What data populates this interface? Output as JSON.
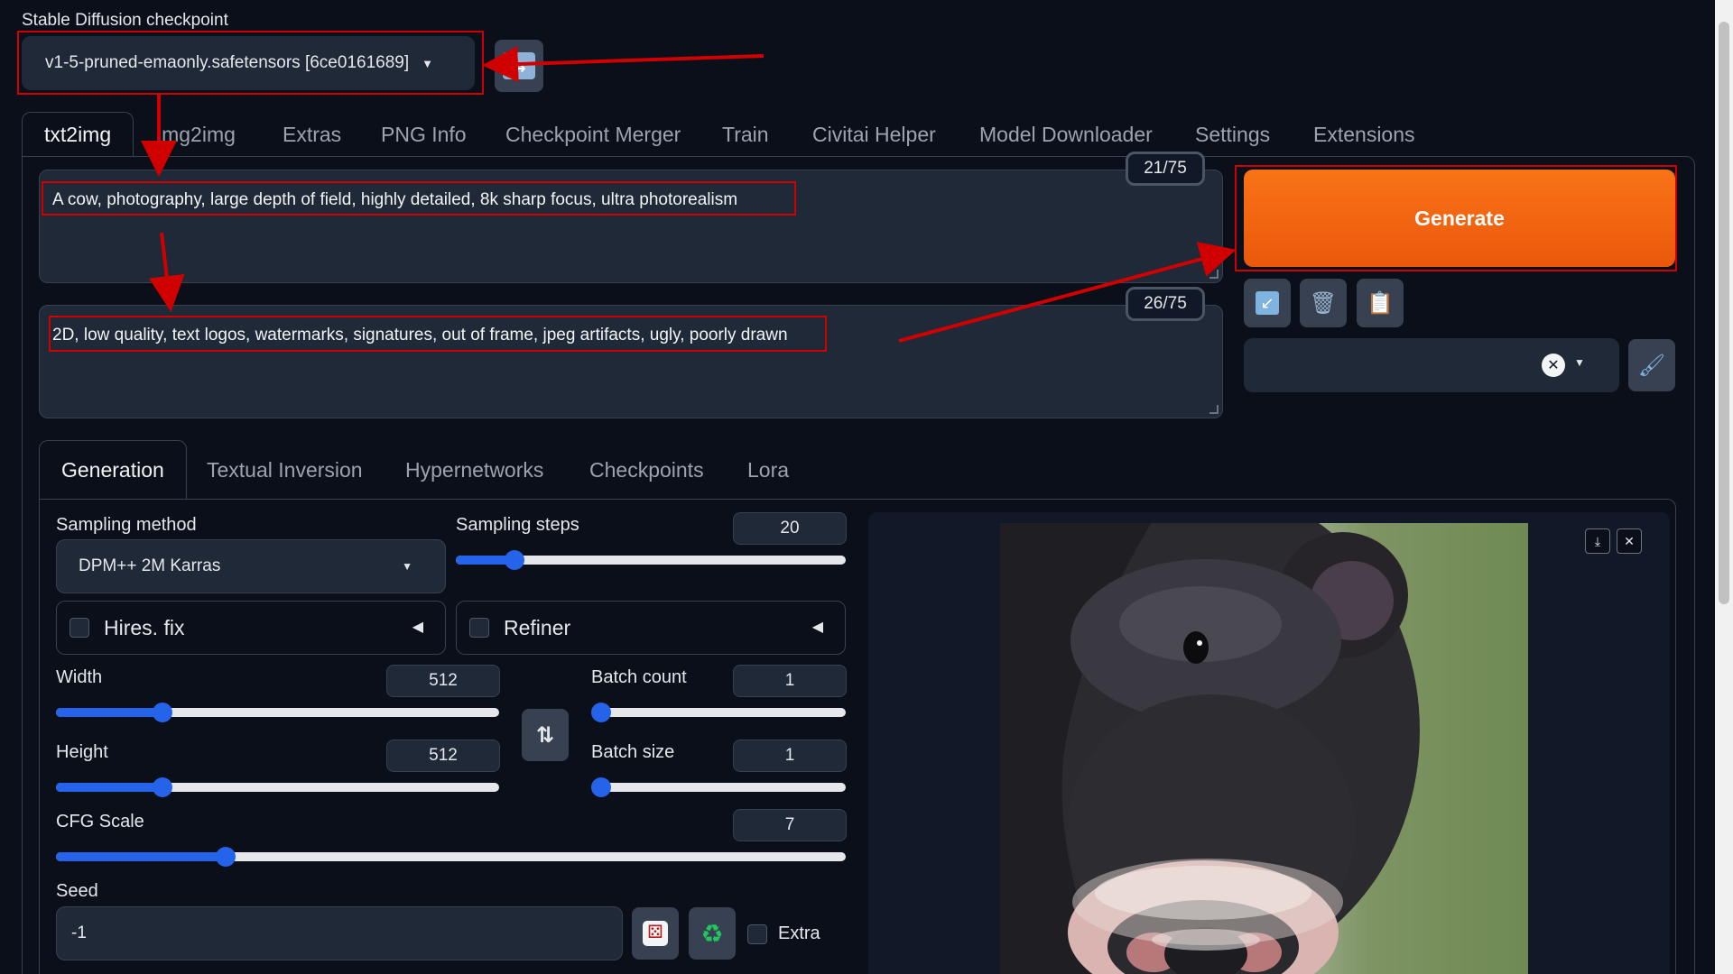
{
  "checkpoint": {
    "label": "Stable Diffusion checkpoint",
    "value": "v1-5-pruned-emaonly.safetensors [6ce0161689]"
  },
  "tabs": [
    "txt2img",
    "img2img",
    "Extras",
    "PNG Info",
    "Checkpoint Merger",
    "Train",
    "Civitai Helper",
    "Model Downloader",
    "Settings",
    "Extensions"
  ],
  "prompt": {
    "text": "A cow, photography, large depth of field, highly detailed, 8k sharp focus, ultra photorealism",
    "counter": "21/75"
  },
  "negative_prompt": {
    "text": "2D, low quality, text logos, watermarks, signatures, out of frame, jpeg artifacts, ugly, poorly drawn",
    "counter": "26/75"
  },
  "generate_label": "Generate",
  "subtabs": [
    "Generation",
    "Textual Inversion",
    "Hypernetworks",
    "Checkpoints",
    "Lora"
  ],
  "params": {
    "sampling_method_label": "Sampling method",
    "sampling_method": "DPM++ 2M Karras",
    "sampling_steps_label": "Sampling steps",
    "sampling_steps": "20",
    "hires_label": "Hires. fix",
    "refiner_label": "Refiner",
    "width_label": "Width",
    "width": "512",
    "height_label": "Height",
    "height": "512",
    "batch_count_label": "Batch count",
    "batch_count": "1",
    "batch_size_label": "Batch size",
    "batch_size": "1",
    "cfg_label": "CFG Scale",
    "cfg": "7",
    "seed_label": "Seed",
    "seed": "-1",
    "extra_label": "Extra"
  },
  "slider_levels": {
    "sampling_steps": 0.15,
    "width": 0.24,
    "height": 0.24,
    "batch_count": 0.0,
    "batch_size": 0.0,
    "cfg": 0.215
  },
  "colors": {
    "generate": "#ea580c",
    "accent": "#2563eb",
    "annotation": "#d00000"
  }
}
